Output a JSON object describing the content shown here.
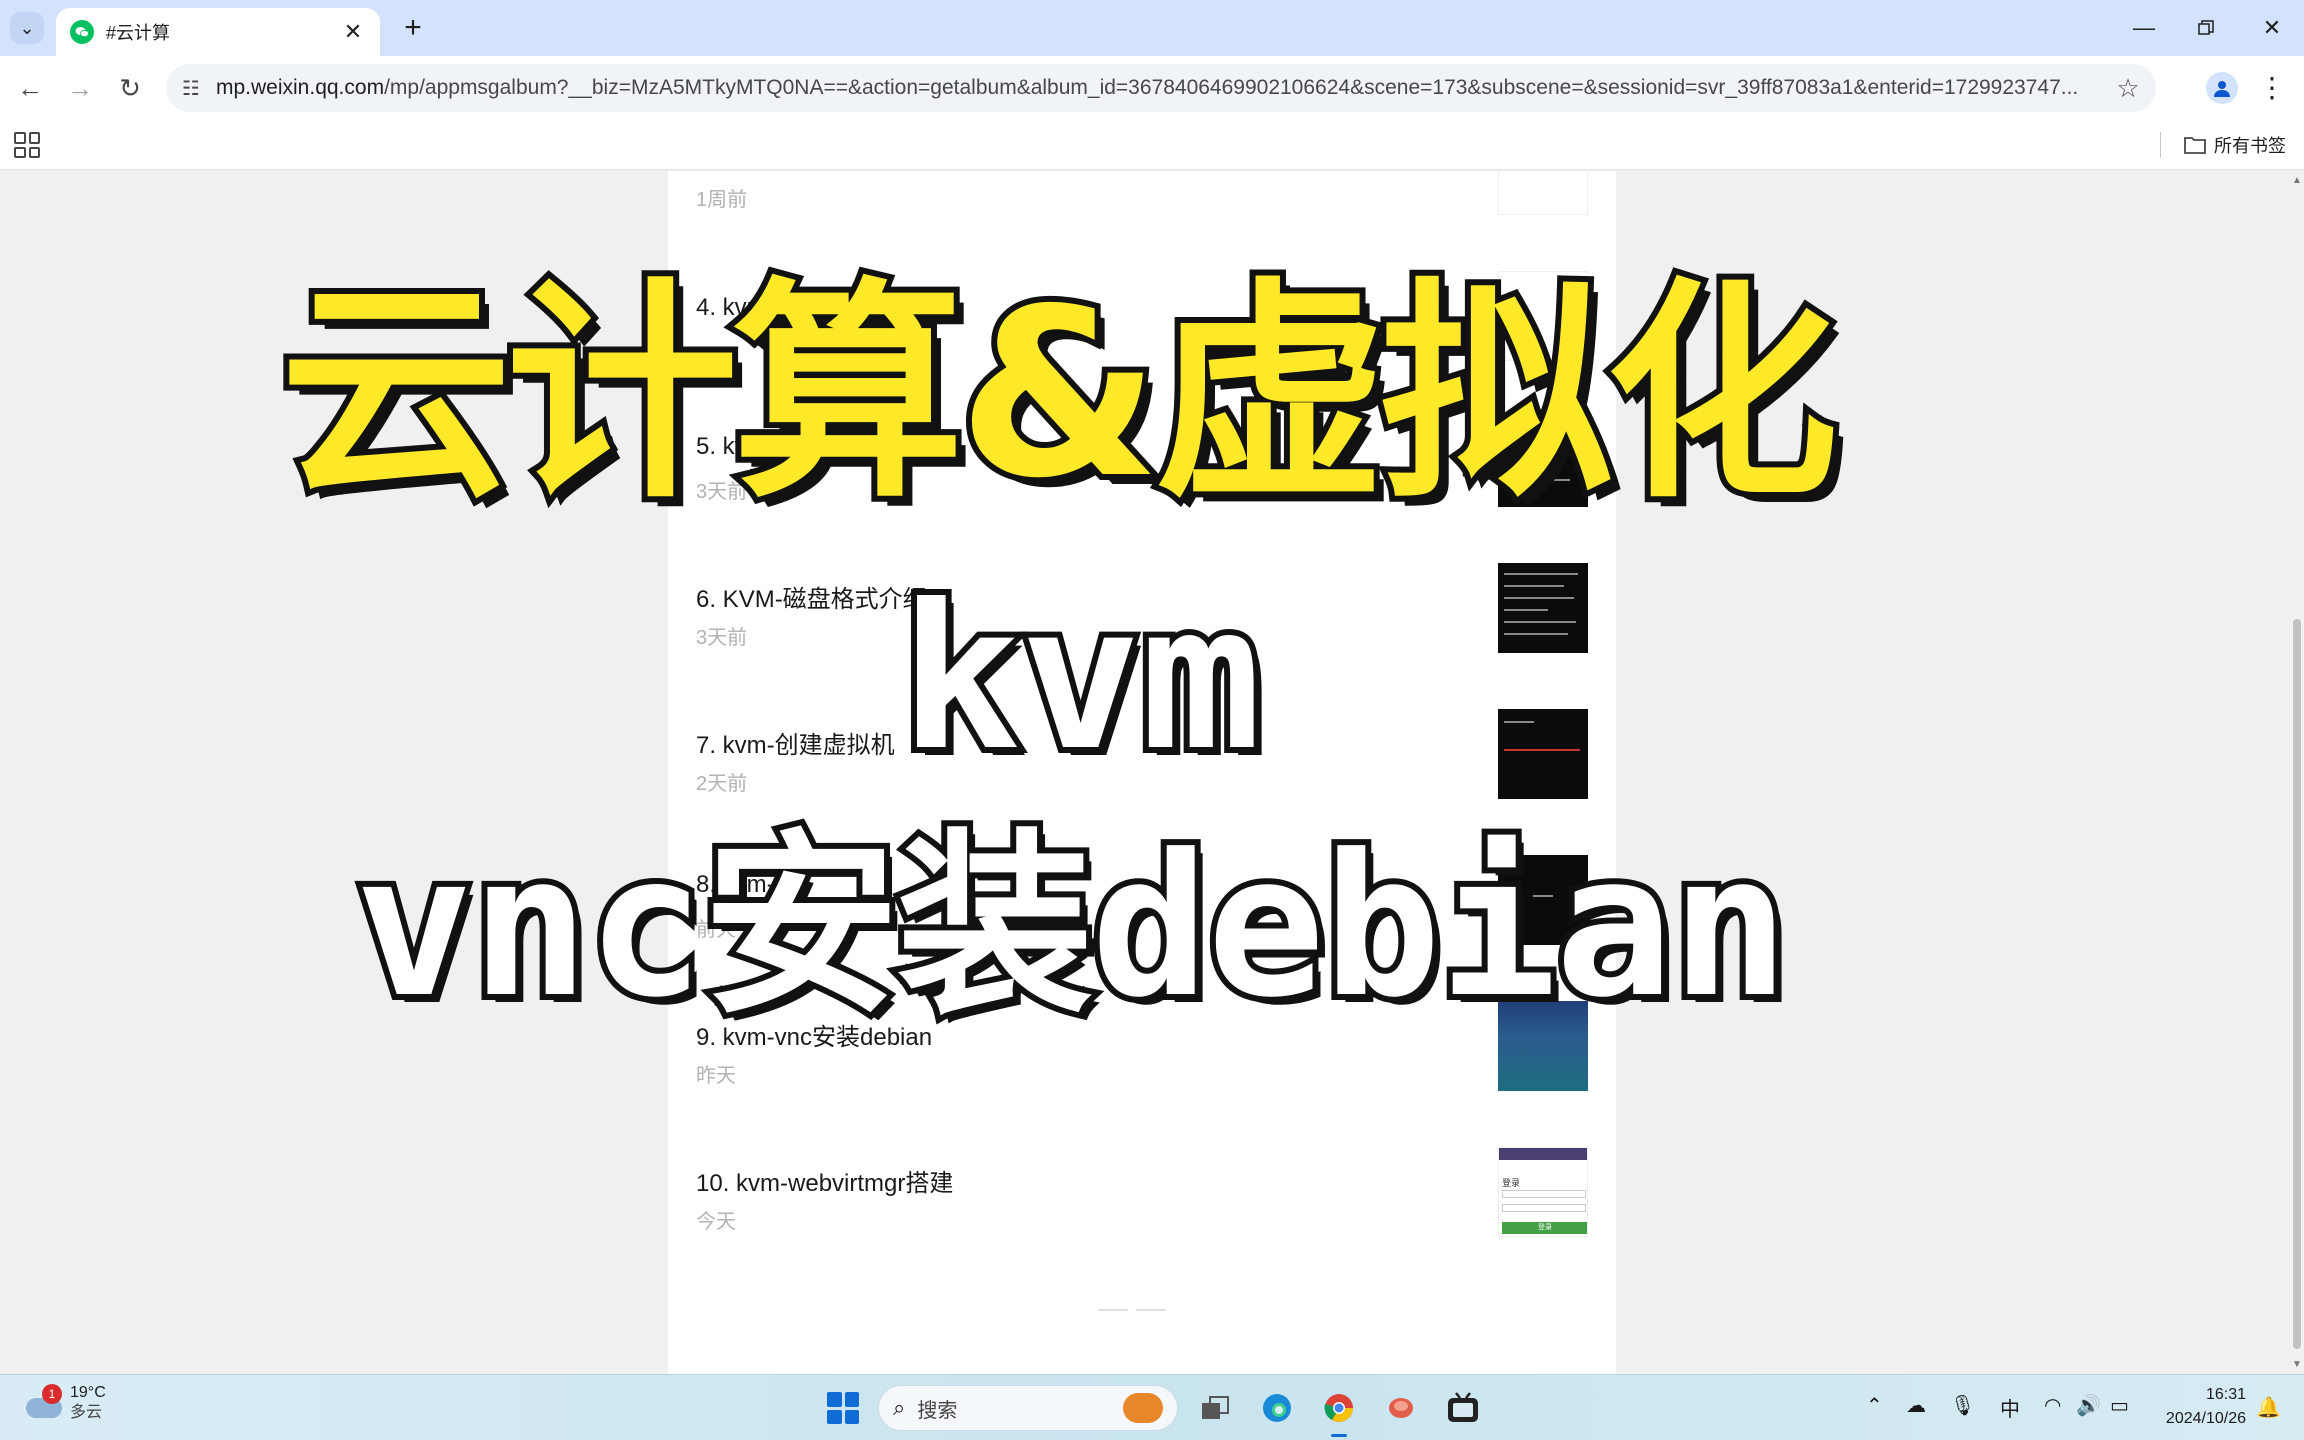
{
  "browser": {
    "tab_title": "#云计算",
    "url_host": "mp.weixin.qq.com",
    "url_path": "/mp/appmsgalbum?__biz=MzA5MTkyMTQ0NA==&action=getalbum&album_id=3678406469902106624&scene=173&subscene=&sessionid=svr_39ff87083a1&enterid=1729923747...",
    "all_bookmarks": "所有书签",
    "icons": {
      "tab_list": "chevron-down-icon",
      "new_tab": "plus-icon",
      "back": "arrow-left-icon",
      "forward": "arrow-right-icon",
      "reload": "reload-icon",
      "site_info": "tune-icon",
      "bookmark": "star-icon",
      "profile": "person-icon",
      "menu": "more-vertical-icon",
      "apps": "grid-icon",
      "folder": "folder-icon"
    }
  },
  "articles": [
    {
      "title": "",
      "time": "1周前",
      "thumb": "light"
    },
    {
      "title": "4. kvm-网络",
      "time": "",
      "thumb": "light"
    },
    {
      "title": "5. kvm-t",
      "time": "3天前",
      "thumb": "dark"
    },
    {
      "title": "6. KVM-磁盘格式介绍",
      "time": "3天前",
      "thumb": "dark"
    },
    {
      "title": "7. kvm-创建虚拟机",
      "time": "2天前",
      "thumb": "dark"
    },
    {
      "title": "8. kvm-",
      "time": "前天",
      "thumb": "dark"
    },
    {
      "title": "9. kvm-vnc安装debian",
      "time": "昨天",
      "thumb": "blue"
    },
    {
      "title": "10. kvm-webvirtmgr搭建",
      "time": "今天",
      "thumb": "login"
    }
  ],
  "thumb_login": {
    "label": "登录",
    "button": "登录"
  },
  "overlay": {
    "title": "云计算&虚拟化",
    "line2": "kvm",
    "line3": "vnc安装debian"
  },
  "taskbar": {
    "weather_temp": "19°C",
    "weather_desc": "多云",
    "weather_badge": "1",
    "search_placeholder": "搜索",
    "ime": "中",
    "time": "16:31",
    "date": "2024/10/26"
  },
  "colors": {
    "overlay_yellow": "#fde928",
    "wechat_green": "#07c160",
    "tabstrip": "#d3e3fd",
    "start_blue": "#0f6cd6"
  }
}
